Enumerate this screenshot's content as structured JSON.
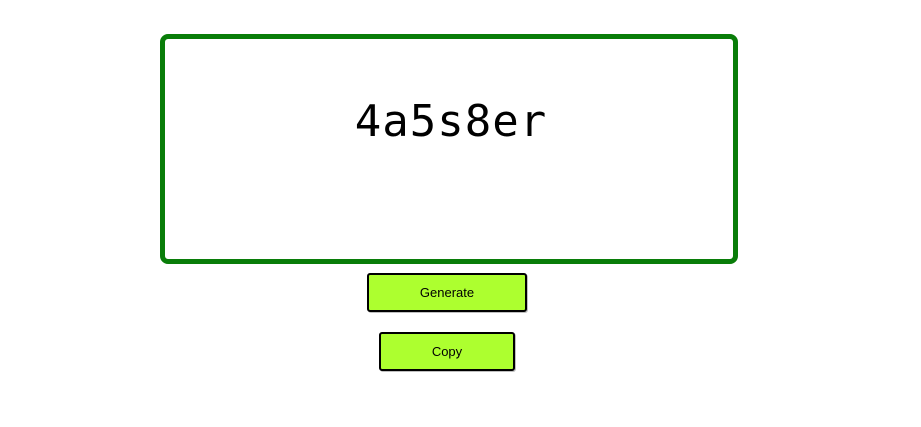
{
  "display": {
    "code": "4a5s8er",
    "border_color": "#097d09"
  },
  "actions": {
    "generate_label": "Generate",
    "copy_label": "Copy",
    "button_color": "#adff2f"
  }
}
